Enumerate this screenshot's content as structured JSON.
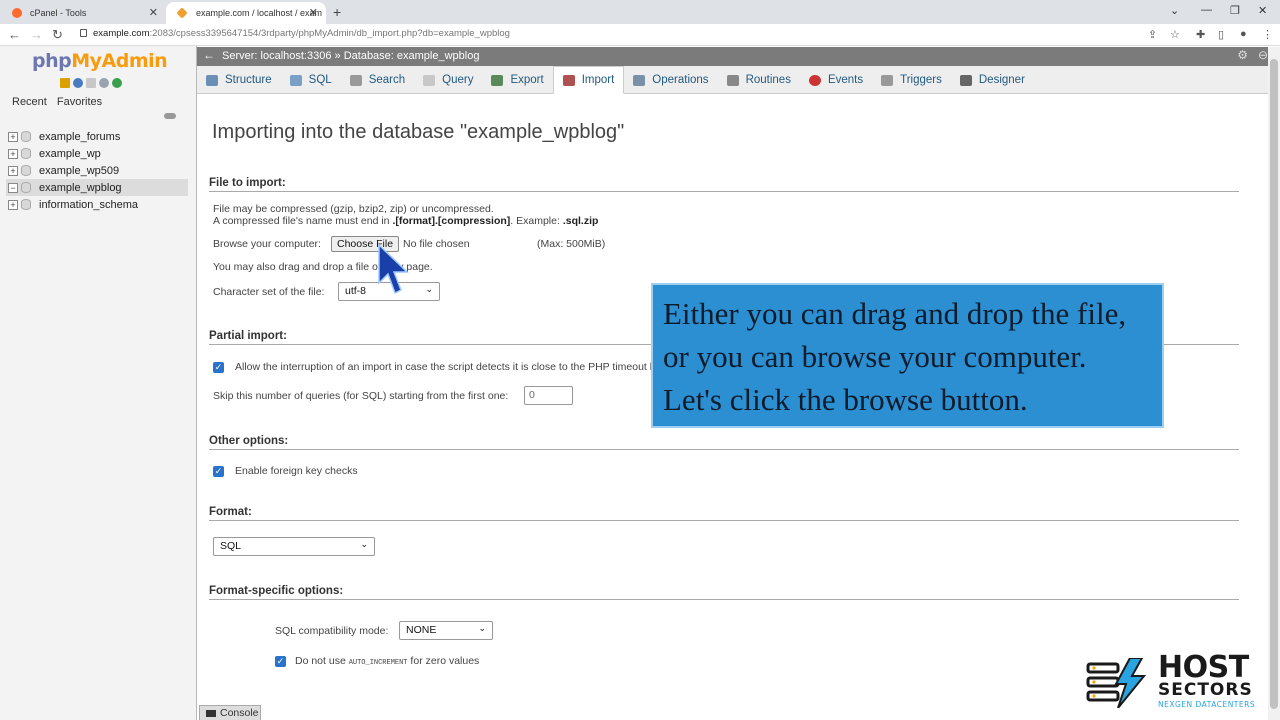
{
  "browser": {
    "tabs": [
      {
        "title": "cPanel - Tools",
        "active": false
      },
      {
        "title": "example.com / localhost / exam",
        "active": true
      }
    ],
    "url_host": "example.com",
    "url_rest": ":2083/cpsess3395647154/3rdparty/phpMyAdmin/db_import.php?db=example_wpblog"
  },
  "nav": {
    "logo_a": "php",
    "logo_b": "MyAdmin",
    "recent": "Recent",
    "favorites": "Favorites",
    "databases": [
      "example_forums",
      "example_wp",
      "example_wp509",
      "example_wpblog",
      "information_schema"
    ],
    "active_db": "example_wpblog"
  },
  "breadcrumb": {
    "server": "Server: localhost:3306",
    "separator": "»",
    "database": "Database: example_wpblog"
  },
  "menu": [
    {
      "label": "Structure",
      "icon": "structure-icon",
      "color": "#6b8fb5"
    },
    {
      "label": "SQL",
      "icon": "sql-icon",
      "color": "#7aa0c8"
    },
    {
      "label": "Search",
      "icon": "search-icon",
      "color": "#999999"
    },
    {
      "label": "Query",
      "icon": "query-icon",
      "color": "#c8c8c8"
    },
    {
      "label": "Export",
      "icon": "export-icon",
      "color": "#5a8a5a"
    },
    {
      "label": "Import",
      "icon": "import-icon",
      "color": "#b05050",
      "active": true
    },
    {
      "label": "Operations",
      "icon": "operations-icon",
      "color": "#7a8fa8"
    },
    {
      "label": "Routines",
      "icon": "routines-icon",
      "color": "#888888"
    },
    {
      "label": "Events",
      "icon": "events-icon",
      "color": "#cc3333"
    },
    {
      "label": "Triggers",
      "icon": "triggers-icon",
      "color": "#999999"
    },
    {
      "label": "Designer",
      "icon": "designer-icon",
      "color": "#666666"
    }
  ],
  "page": {
    "title": "Importing into the database \"example_wpblog\""
  },
  "file_import": {
    "heading": "File to import:",
    "compress_note": "File may be compressed (gzip, bzip2, zip) or uncompressed.",
    "name_note_a": "A compressed file's name must end in ",
    "name_note_b": ".[format].[compression]",
    "name_note_c": ". Example: ",
    "name_note_d": ".sql.zip",
    "browse_label": "Browse your computer:",
    "choose_button": "Choose File",
    "no_file": "No file chosen",
    "max_size": "(Max: 500MiB)",
    "drag_note": "You may also drag and drop a file on any page.",
    "charset_label": "Character set of the file:",
    "charset_value": "utf-8"
  },
  "partial_import": {
    "heading": "Partial import:",
    "allow_interrupt": "Allow the interruption of an import in case the script detects it is close to the PHP timeout limit.",
    "skip_label": "Skip this number of queries (for SQL) starting from the first one:",
    "skip_value": "0"
  },
  "other_options": {
    "heading": "Other options:",
    "foreign_keys": "Enable foreign key checks"
  },
  "format": {
    "heading": "Format:",
    "value": "SQL"
  },
  "format_specific": {
    "heading": "Format-specific options:",
    "compat_label": "SQL compatibility mode:",
    "compat_value": "NONE",
    "autoinc_a": "Do not use ",
    "autoinc_code": "AUTO_INCREMENT",
    "autoinc_b": " for zero values"
  },
  "console": "Console",
  "callout": {
    "lines": [
      "Either you can drag and drop the file,",
      "or you can browse your computer.",
      "Let's click the browse button."
    ]
  },
  "watermark": {
    "host": "HOST",
    "sectors": "SECTORS",
    "tagline": "NEXGEN DATACENTERS"
  }
}
